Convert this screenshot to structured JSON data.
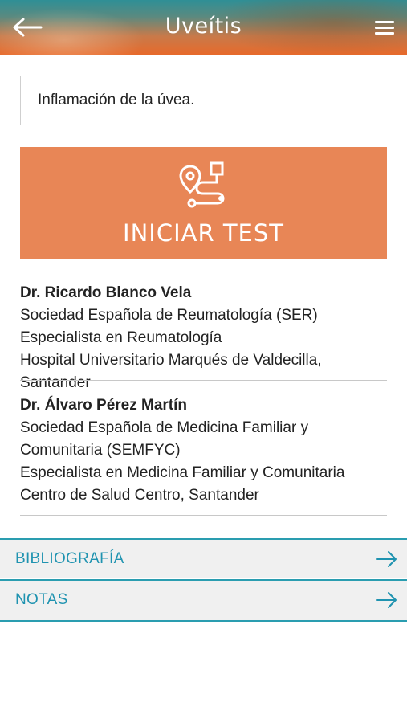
{
  "header": {
    "title": "Uveítis",
    "back_icon": "back-arrow-icon",
    "menu_icon": "hamburger-menu-icon"
  },
  "description": "Inflamación de la úvea.",
  "start_test": {
    "label": "INICIAR TEST",
    "icon": "route-icon",
    "color": "#e88656"
  },
  "authors": [
    {
      "name": "Dr. Ricardo Blanco Vela",
      "lines": [
        "Sociedad Española de Reumatología (SER)",
        "Especialista en Reumatología",
        "Hospital Universitario Marqués de Valdecilla, Santander"
      ]
    },
    {
      "name": "Dr. Álvaro Pérez Martín",
      "lines": [
        "Sociedad Española de Medicina Familiar y Comunitaria (SEMFYC)",
        "Especialista en Medicina Familiar y Comunitaria",
        "Centro de Salud Centro, Santander"
      ]
    }
  ],
  "nav": [
    {
      "label": "BIBLIOGRAFÍA",
      "icon": "arrow-right-icon"
    },
    {
      "label": "NOTAS",
      "icon": "arrow-right-icon"
    }
  ],
  "colors": {
    "accent": "#1f93b0",
    "header_bottom": "#e8692a"
  }
}
